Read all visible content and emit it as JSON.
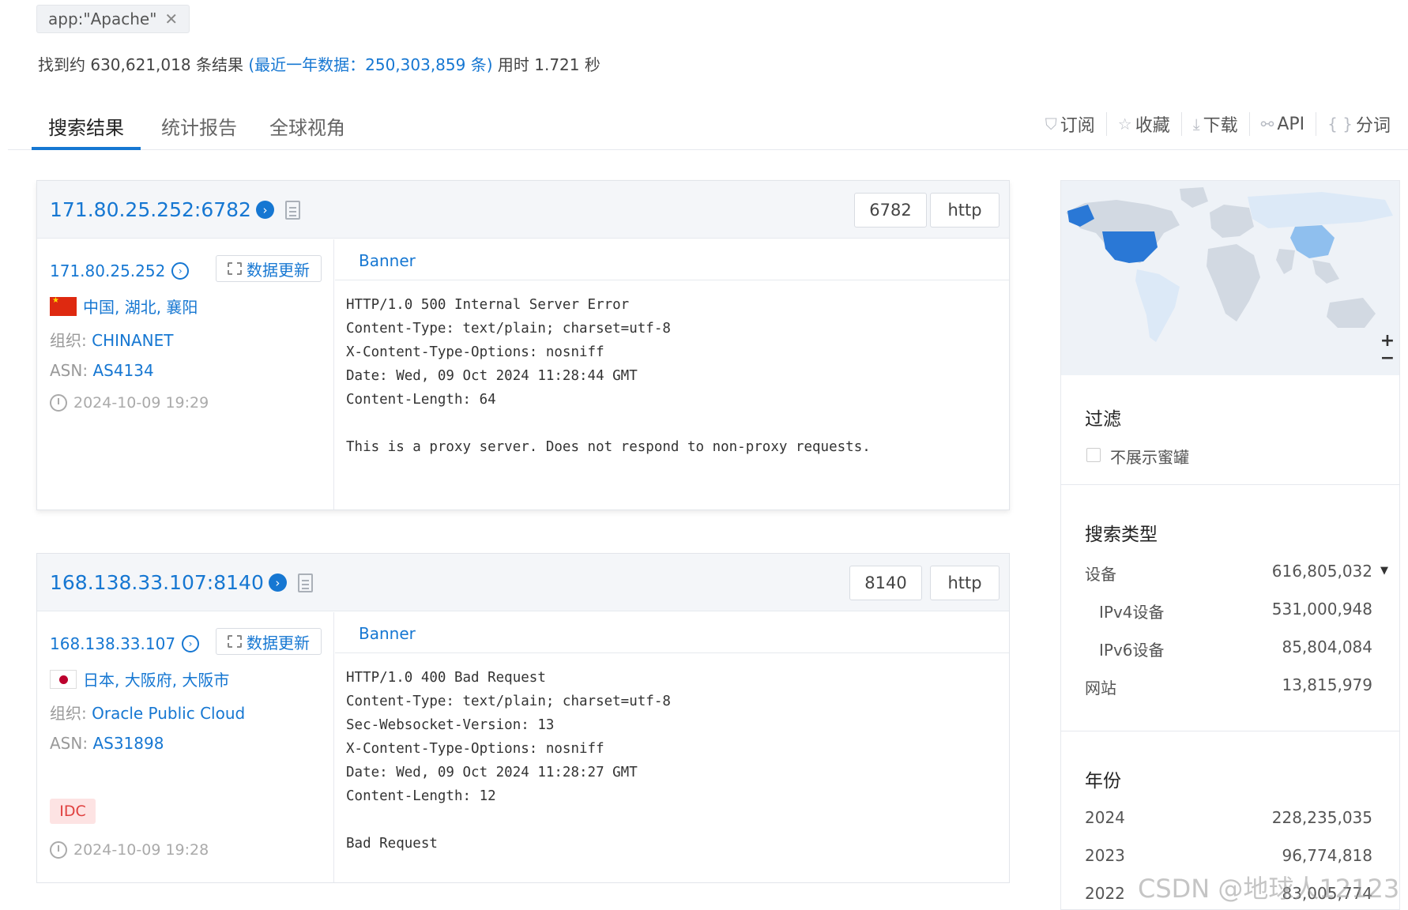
{
  "query": {
    "text": "app:\"Apache\"",
    "close": "✕"
  },
  "summary": {
    "prefix": "找到约 630,621,018 条结果",
    "recent": "(最近一年数据：250,303,859 条)",
    "elapsed": "用时 1.721 秒"
  },
  "tabs": [
    "搜索结果",
    "统计报告",
    "全球视角"
  ],
  "toolbar": [
    {
      "icon": "bookmark-icon",
      "glyph": "⛉",
      "label": "订阅"
    },
    {
      "icon": "star-icon",
      "glyph": "☆",
      "label": "收藏"
    },
    {
      "icon": "download-icon",
      "glyph": "⤓",
      "label": "下载"
    },
    {
      "icon": "link-icon",
      "glyph": "⚯",
      "label": "API"
    },
    {
      "icon": "braces-icon",
      "glyph": "{ }",
      "label": "分词"
    }
  ],
  "results": [
    {
      "title": "171.80.25.252:6782",
      "port": "6782",
      "protocol": "http",
      "ip": "171.80.25.252",
      "update": "数据更新",
      "location": "中国, 湖北, 襄阳",
      "org_label": "组织:",
      "org": "CHINANET",
      "asn_label": "ASN:",
      "asn": "AS4134",
      "time": "2024-10-09 19:29",
      "banner_tab": "Banner",
      "banner": "HTTP/1.0 500 Internal Server Error\nContent-Type: text/plain; charset=utf-8\nX-Content-Type-Options: nosniff\nDate: Wed, 09 Oct 2024 11:28:44 GMT\nContent-Length: 64\n\nThis is a proxy server. Does not respond to non-proxy requests."
    },
    {
      "title": "168.138.33.107:8140",
      "port": "8140",
      "protocol": "http",
      "ip": "168.138.33.107",
      "update": "数据更新",
      "location": "日本, 大阪府, 大阪市",
      "org_label": "组织:",
      "org": "Oracle Public Cloud",
      "asn_label": "ASN:",
      "asn": "AS31898",
      "tag": "IDC",
      "time": "2024-10-09 19:28",
      "banner_tab": "Banner",
      "banner": "HTTP/1.0 400 Bad Request\nContent-Type: text/plain; charset=utf-8\nSec-Websocket-Version: 13\nX-Content-Type-Options: nosniff\nDate: Wed, 09 Oct 2024 11:28:27 GMT\nContent-Length: 12\n\nBad Request"
    }
  ],
  "sidebar": {
    "zoom_in": "+",
    "zoom_out": "−",
    "filter_title": "过滤",
    "filter_option": "不展示蜜罐",
    "search_type_title": "搜索类型",
    "search_types": [
      {
        "label": "设备",
        "count": "616,805,032"
      },
      {
        "label": "IPv4设备",
        "count": "531,000,948"
      },
      {
        "label": "IPv6设备",
        "count": "85,804,084"
      },
      {
        "label": "网站",
        "count": "13,815,979"
      }
    ],
    "year_title": "年份",
    "years": [
      {
        "label": "2024",
        "count": "228,235,035"
      },
      {
        "label": "2023",
        "count": "96,774,818"
      },
      {
        "label": "2022",
        "count": "83,005,774"
      }
    ]
  },
  "watermark": "CSDN @地球人12123",
  "colors": {
    "accent": "#1677d2",
    "map_us": "#2a78d6",
    "map_cn": "#8fbfee"
  }
}
